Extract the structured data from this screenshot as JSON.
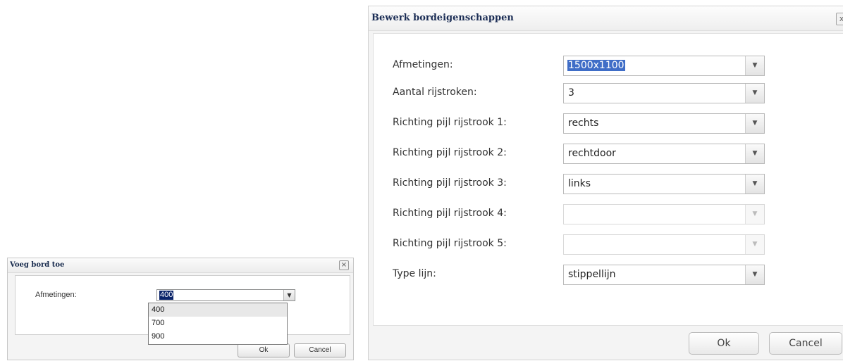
{
  "small_dialog": {
    "title": "Voeg bord toe",
    "close_symbol": "×",
    "label": "Afmetingen:",
    "selected_value": "400",
    "options": [
      "400",
      "700",
      "900"
    ],
    "ok_label": "Ok",
    "cancel_label": "Cancel"
  },
  "big_dialog": {
    "title": "Bewerk bordeigenschappen",
    "close_symbol": "x",
    "fields": [
      {
        "label": "Afmetingen:",
        "value": "1500x1100"
      },
      {
        "label": "Aantal rijstroken:",
        "value": "3"
      },
      {
        "label": "Richting pijl rijstrook 1:",
        "value": "rechts"
      },
      {
        "label": "Richting pijl rijstrook 2:",
        "value": "rechtdoor"
      },
      {
        "label": "Richting pijl rijstrook 3:",
        "value": "links"
      },
      {
        "label": "Richting pijl rijstrook 4:",
        "value": ""
      },
      {
        "label": "Richting pijl rijstrook 5:",
        "value": ""
      },
      {
        "label": "Type lijn:",
        "value": "stippellijn"
      }
    ],
    "ok_label": "Ok",
    "cancel_label": "Cancel"
  },
  "icons": {
    "dropdown_arrow": "chevron-down-icon",
    "close": "close-icon"
  },
  "colors": {
    "selection_highlight": "#3f6dc7",
    "small_selection_highlight": "#0a246a",
    "title_text": "#1b2d55"
  }
}
